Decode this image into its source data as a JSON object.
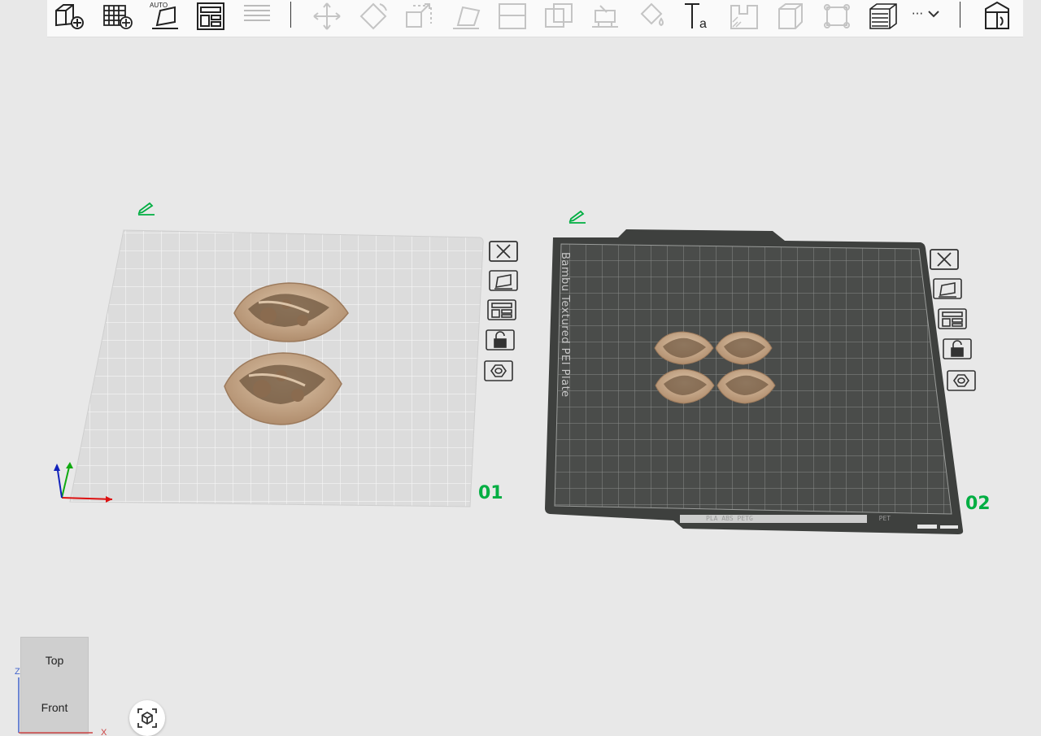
{
  "colors": {
    "background": "#e8e8e8",
    "accent_green": "#00ae42",
    "textured_plate": "#4a4c4a",
    "plain_plate": "#dcdcdc",
    "model_color": "#c9aa8b"
  },
  "toolbar": {
    "icons": [
      "add-object-icon",
      "add-plate-icon",
      "auto-orient-icon",
      "arrange-icon",
      "split-to-objects-icon",
      "move-icon",
      "rotate-icon",
      "scale-icon",
      "lay-on-face-icon",
      "cut-icon",
      "boolean-icon",
      "support-paint-icon",
      "color-paint-icon",
      "text-emboss-icon",
      "seam-paint-icon",
      "fuzzy-skin-icon",
      "measure-icon",
      "variable-layer-icon",
      "assembly-view-icon"
    ],
    "more_label": "···",
    "auto_label": "AUTO"
  },
  "plates": [
    {
      "number": "01",
      "label": "",
      "buttons": [
        "close-icon",
        "auto-orient-icon",
        "arrange-icon",
        "lock-icon",
        "plate-settings-icon"
      ]
    },
    {
      "number": "02",
      "label": "Bambu Textured PEI Plate",
      "bottom_text": "PLA ABS PETG",
      "bottom_text_right": "PET",
      "buttons": [
        "close-icon",
        "auto-orient-icon",
        "arrange-icon",
        "lock-icon",
        "plate-settings-icon"
      ]
    }
  ],
  "navcube": {
    "top": "Top",
    "front": "Front",
    "axis_z": "Z",
    "axis_x": "X"
  },
  "view_button": {
    "icon": "fit-view-icon"
  }
}
